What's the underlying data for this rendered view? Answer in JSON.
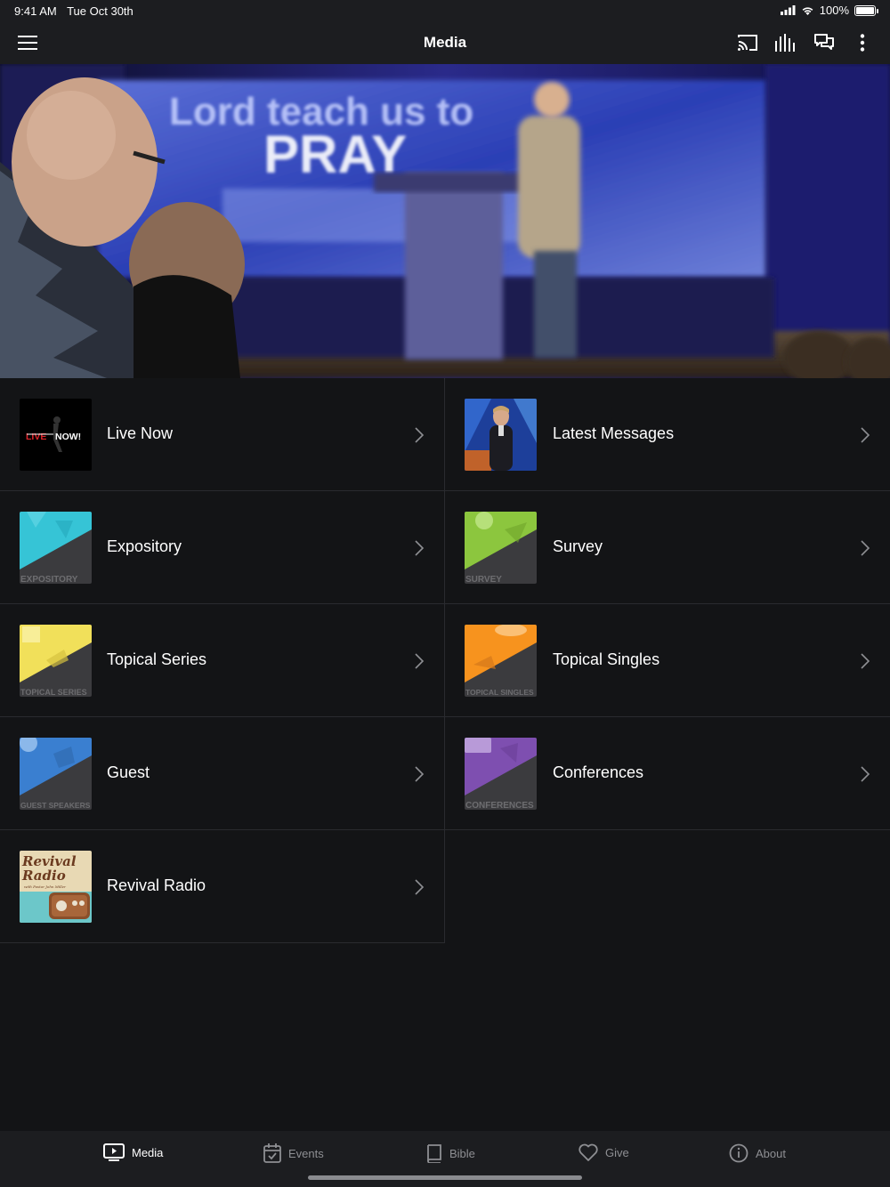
{
  "status": {
    "time": "9:41 AM",
    "date": "Tue Oct 30th",
    "battery": "100%"
  },
  "navbar": {
    "title": "Media",
    "icons": [
      "menu-icon",
      "cast-icon",
      "audio-bars-icon",
      "chat-icon",
      "more-vertical-icon"
    ]
  },
  "hero": {
    "screen_text_line1": "Lord teach us to",
    "screen_text_line2": "PRAY"
  },
  "items": [
    {
      "label": "Live Now",
      "thumb_text": "LIVE NOW!"
    },
    {
      "label": "Latest Messages",
      "thumb_text": ""
    },
    {
      "label": "Expository",
      "thumb_text": "EXPOSITORY",
      "color": "#36c4d6"
    },
    {
      "label": "Survey",
      "thumb_text": "SURVEY",
      "color": "#8cc63e"
    },
    {
      "label": "Topical Series",
      "thumb_text": "TOPICAL SERIES",
      "color": "#f1e05a"
    },
    {
      "label": "Topical Singles",
      "thumb_text": "TOPICAL SINGLES",
      "color": "#f7931e"
    },
    {
      "label": "Guest",
      "thumb_text": "GUEST SPEAKERS",
      "color": "#3a7fd0"
    },
    {
      "label": "Conferences",
      "thumb_text": "CONFERENCES",
      "color": "#7e4fb0"
    },
    {
      "label": "Revival Radio",
      "thumb_text_line1": "Revival",
      "thumb_text_line2": "Radio",
      "thumb_text_line3": "with Pastor John Miller"
    }
  ],
  "tabs": [
    {
      "label": "Media",
      "icon": "media-icon",
      "active": true
    },
    {
      "label": "Events",
      "icon": "calendar-icon",
      "active": false
    },
    {
      "label": "Bible",
      "icon": "bible-icon",
      "active": false
    },
    {
      "label": "Give",
      "icon": "heart-icon",
      "active": false
    },
    {
      "label": "About",
      "icon": "info-icon",
      "active": false
    }
  ]
}
